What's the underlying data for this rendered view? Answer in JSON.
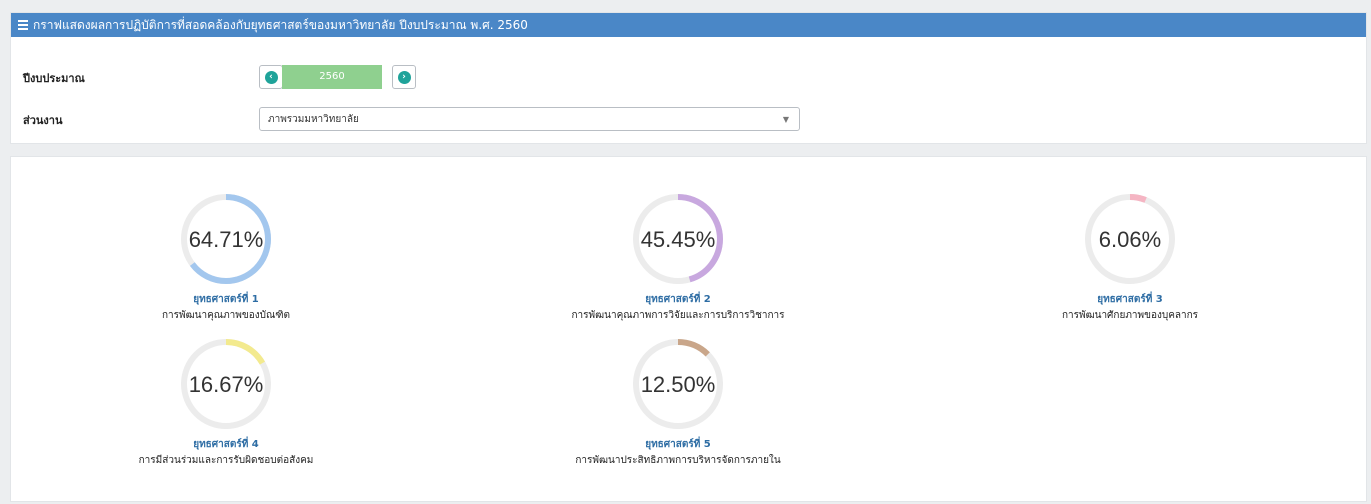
{
  "header": {
    "title": "กราฟแสดงผลการปฏิบัติการที่สอดคล้องกับยุทธศาสตร์ของมหาวิทยาลัย ปีงบประมาณ พ.ศ. 2560"
  },
  "filters": {
    "year_label": "ปีงบประมาณ",
    "year_value": "2560",
    "prev_icon": "chevron-left-icon",
    "next_icon": "chevron-right-icon",
    "unit_label": "ส่วนงาน",
    "unit_value": "ภาพรวมมหาวิทยาลัย"
  },
  "gauges": [
    {
      "value": 64.71,
      "label": "64.71%",
      "title": "ยุทธศาสตร์ที่ 1",
      "subtitle": "การพัฒนาคุณภาพของบัณฑิต",
      "color": "#a3c7ee"
    },
    {
      "value": 45.45,
      "label": "45.45%",
      "title": "ยุทธศาสตร์ที่ 2",
      "subtitle": "การพัฒนาคุณภาพการวิจัยและการบริการวิชาการ",
      "color": "#c8a8df"
    },
    {
      "value": 6.06,
      "label": "6.06%",
      "title": "ยุทธศาสตร์ที่ 3",
      "subtitle": "การพัฒนาศักยภาพของบุคลากร",
      "color": "#f5b5c3"
    },
    {
      "value": 16.67,
      "label": "16.67%",
      "title": "ยุทธศาสตร์ที่ 4",
      "subtitle": "การมีส่วนร่วมและการรับผิดชอบต่อสังคม",
      "color": "#f3ea8e"
    },
    {
      "value": 12.5,
      "label": "12.50%",
      "title": "ยุทธศาสตร์ที่ 5",
      "subtitle": "การพัฒนาประสิทธิภาพการบริหารจัดการภายใน",
      "color": "#c9a68a"
    }
  ]
}
